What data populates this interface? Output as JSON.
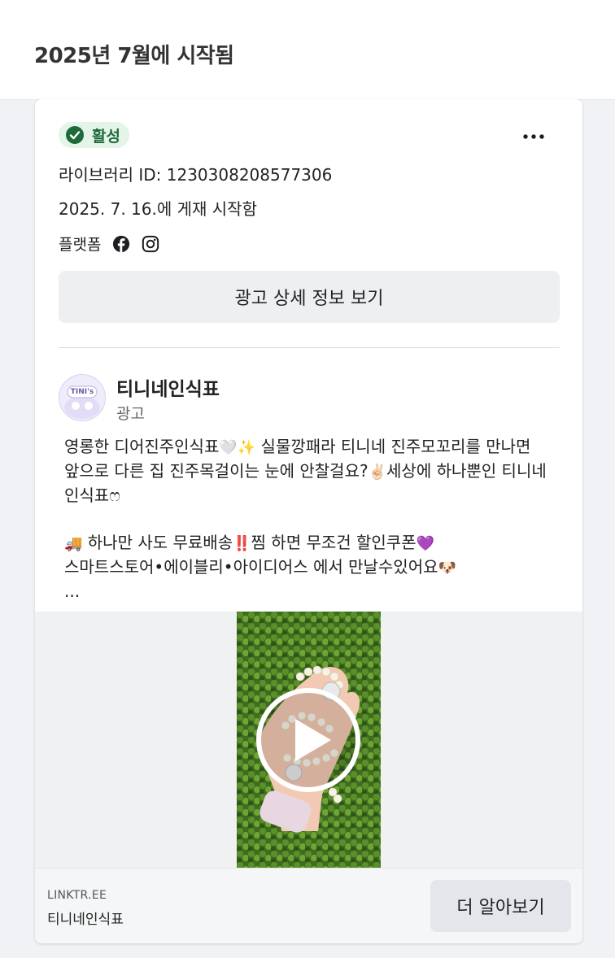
{
  "header": {
    "title": "2025년 7월에 시작됨"
  },
  "ad": {
    "status": "활성",
    "library_id": "라이브러리 ID: 1230308208577306",
    "started": "2025. 7. 16.에 게재 시작함",
    "platform_label": "플랫폼",
    "platforms": [
      "facebook-icon",
      "instagram-icon"
    ],
    "details_button": "광고 상세 정보 보기",
    "advertiser": {
      "name": "티니네인식표",
      "sponsored": "광고",
      "avatar_text": "TINI's"
    },
    "body_lines": {
      "l1": "영롱한 디어진주인식표",
      "l1_emoji": "🤍✨",
      "l1_rest": " 실물깡패라 티니네 진주모꼬리를 만나면 앞으로 다른 집 진주목걸이는 눈에 안찰걸요?",
      "l1_emoji2": "✌🏻",
      "l1_tail": "세상에 하나뿐인 티니네 인식표ෆ",
      "l2_emoji": "🚚",
      "l2": " 하나만 사도 무료배송",
      "l2_emoji2": "‼️",
      "l2_rest": "찜 하면 무조건 할인쿠폰",
      "l2_emoji3": "💜",
      "l3": "스마트스토어•에이블리•아이디어스 에서 만날수있어요",
      "l3_emoji": "🐶",
      "ellipsis": "..."
    },
    "link": {
      "domain": "LINKTR.EE",
      "title": "티니네인식표",
      "cta": "더 알아보기"
    }
  },
  "colors": {
    "status_bg": "#e5f4e9",
    "status_fg": "#1e6b3a",
    "button_bg": "#eeeff1",
    "page_bg": "#f0f2f5"
  }
}
